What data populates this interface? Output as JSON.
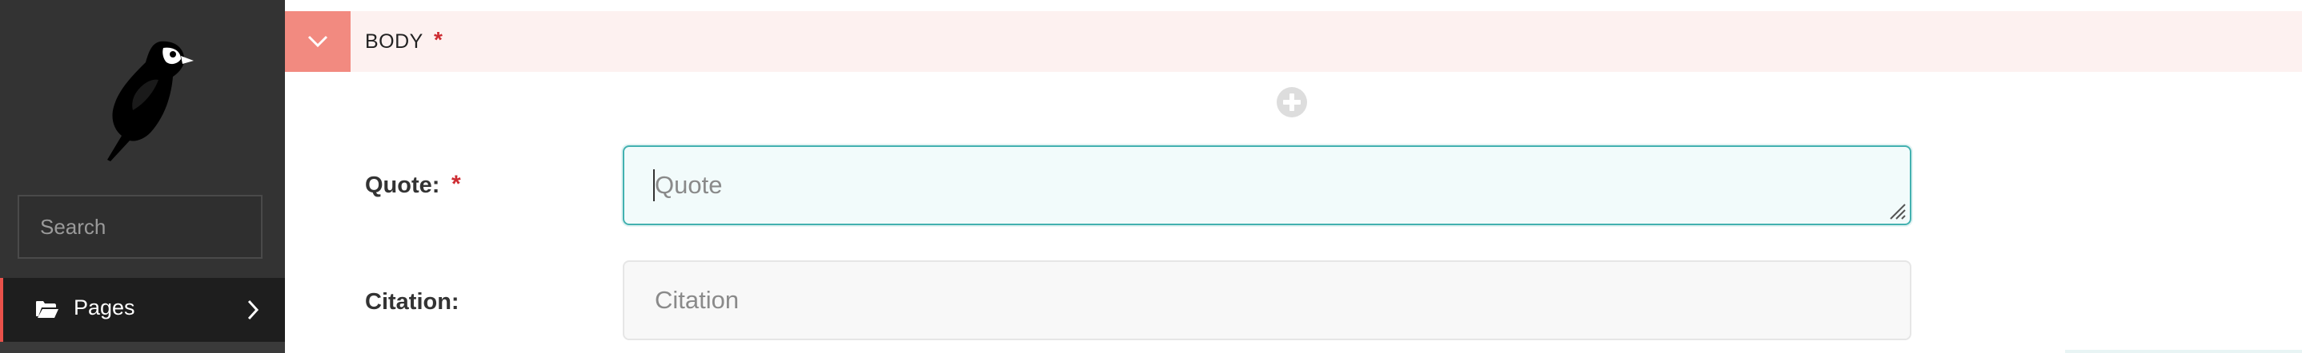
{
  "sidebar": {
    "logo_icon": "wagtail-bird-logo",
    "search": {
      "placeholder": "Search",
      "icon": "search-icon"
    },
    "nav": [
      {
        "label": "Pages",
        "icon": "folder-open-icon",
        "chevron": "chevron-right-icon"
      }
    ]
  },
  "block": {
    "label": "BODY",
    "required_marker": "*",
    "toggle_icon": "chevron-down-icon"
  },
  "fields": {
    "quote": {
      "label": "Quote:",
      "required_marker": "*",
      "value": "",
      "placeholder": "Quote"
    },
    "citation": {
      "label": "Citation:",
      "value": "",
      "placeholder": "Citation"
    }
  },
  "colors": {
    "sidebar_bg": "#333333",
    "active_nav_bg": "#1e1e1e",
    "accent_red": "#e9514a",
    "block_bar_bg": "#fdf1f0",
    "block_toggle_bg": "#f28a80",
    "focus_teal": "#43b1b0",
    "required_red": "#cd2b31"
  }
}
